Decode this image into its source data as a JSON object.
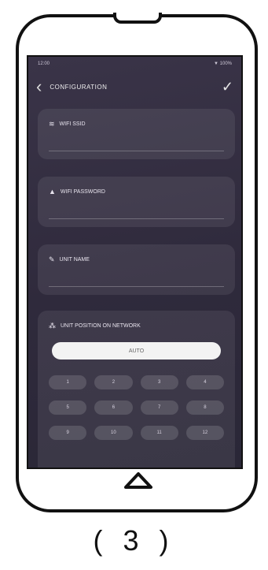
{
  "status": {
    "time": "12:00",
    "right": "▼ 100%"
  },
  "appbar": {
    "title": "CONFIGURATION"
  },
  "fields": [
    {
      "label": "WIFI SSID"
    },
    {
      "label": "WIFI PASSWORD"
    },
    {
      "label": "UNIT NAME"
    }
  ],
  "network": {
    "label": "UNIT POSITION ON NETWORK",
    "auto": "AUTO",
    "keys": [
      "1",
      "2",
      "3",
      "4",
      "5",
      "6",
      "7",
      "8",
      "9",
      "10",
      "11",
      "12"
    ]
  },
  "caption": "( 3 )"
}
